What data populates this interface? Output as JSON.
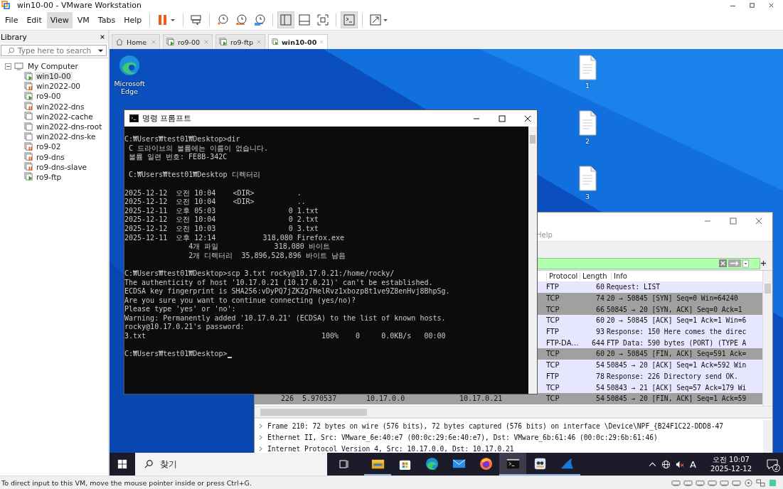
{
  "window": {
    "title": "win10-00 - VMware Workstation"
  },
  "menu": [
    {
      "label": "File",
      "selected": false
    },
    {
      "label": "Edit",
      "selected": false
    },
    {
      "label": "View",
      "selected": true
    },
    {
      "label": "VM",
      "selected": false
    },
    {
      "label": "Tabs",
      "selected": false
    },
    {
      "label": "Help",
      "selected": false
    }
  ],
  "toolbar": [
    {
      "kind": "pause",
      "selected": false
    },
    {
      "kind": "send-keys",
      "selected": false
    },
    {
      "kind": "snapshot-take",
      "selected": false
    },
    {
      "kind": "snapshot-revert",
      "selected": false
    },
    {
      "kind": "snapshot-manager",
      "selected": false
    },
    {
      "kind": "library-view",
      "selected": true
    },
    {
      "kind": "thumbnail-bar",
      "selected": false
    },
    {
      "kind": "full-screen",
      "selected": false
    },
    {
      "kind": "console-view",
      "selected": true
    },
    {
      "kind": "stretch",
      "selected": false
    }
  ],
  "library": {
    "title": "Library",
    "search": {
      "placeholder": "Type here to search"
    },
    "tree": [
      {
        "label": "My Computer",
        "expanded": true,
        "children": [
          {
            "label": "win10-00",
            "running": true,
            "paused": false,
            "selected": true
          },
          {
            "label": "win2022-00",
            "running": false,
            "paused": true,
            "selected": false
          },
          {
            "label": "ro9-00",
            "running": true,
            "paused": false,
            "selected": false
          },
          {
            "label": "win2022-dns",
            "running": false,
            "paused": true,
            "selected": false
          },
          {
            "label": "win2022-cache",
            "running": false,
            "paused": false,
            "selected": false
          },
          {
            "label": "win2022-dns-root",
            "running": false,
            "paused": false,
            "selected": false
          },
          {
            "label": "win2022-dns-ke",
            "running": false,
            "paused": false,
            "selected": false
          },
          {
            "label": "ro9-02",
            "running": false,
            "paused": true,
            "selected": false
          },
          {
            "label": "ro9-dns",
            "running": false,
            "paused": true,
            "selected": false
          },
          {
            "label": "ro9-dns-slave",
            "running": false,
            "paused": true,
            "selected": false
          },
          {
            "label": "ro9-ftp",
            "running": true,
            "paused": false,
            "selected": false
          }
        ]
      }
    ]
  },
  "tabs": [
    {
      "label": "Home",
      "kind": "home",
      "selected": false
    },
    {
      "label": "ro9-00",
      "kind": "vm",
      "selected": false
    },
    {
      "label": "ro9-ftp",
      "kind": "vm",
      "selected": false
    },
    {
      "label": "win10-00",
      "kind": "vm",
      "selected": true
    }
  ],
  "desktop": {
    "icons": [
      {
        "label": "Microsoft Edge",
        "kind": "edge"
      },
      {
        "label": "1",
        "kind": "file"
      },
      {
        "label": "2",
        "kind": "file"
      },
      {
        "label": "3",
        "kind": "file"
      }
    ]
  },
  "wireshark": {
    "menu_fragment": "Help",
    "columns": [
      {
        "label": "Protocol"
      },
      {
        "label": "Length"
      },
      {
        "label": "Info"
      }
    ],
    "packets": [
      {
        "protocol": "FTP",
        "length": "60",
        "info": "Request: LIST",
        "color": "#e7e6ff"
      },
      {
        "protocol": "TCP",
        "length": "74",
        "info": "20 → 50845 [SYN] Seq=0 Win=64240",
        "color": "#a0a0a0"
      },
      {
        "protocol": "TCP",
        "length": "66",
        "info": "50845 → 20 [SYN, ACK] Seq=0 Ack=1",
        "color": "#a0a0a0"
      },
      {
        "protocol": "TCP",
        "length": "60",
        "info": "20 → 50845 [ACK] Seq=1 Ack=1 Win=6",
        "color": "#e7e6ff"
      },
      {
        "protocol": "FTP",
        "length": "93",
        "info": "Response: 150 Here comes the direc",
        "color": "#e7e6ff"
      },
      {
        "protocol": "FTP-DA…",
        "length": "644",
        "info": "FTP Data: 590 bytes (PORT) (TYPE A",
        "color": "#e7e6ff"
      },
      {
        "protocol": "TCP",
        "length": "60",
        "info": "20 → 50845 [FIN, ACK] Seq=591 Ack=",
        "color": "#a0a0a0"
      },
      {
        "protocol": "TCP",
        "length": "54",
        "info": "50845 → 20 [ACK] Seq=1 Ack=592 Win",
        "color": "#e7e6ff"
      },
      {
        "protocol": "FTP",
        "length": "78",
        "info": "Response: 226 Directory send OK.",
        "color": "#e7e6ff"
      },
      {
        "protocol": "TCP",
        "length": "54",
        "info": "50843 → 21 [ACK] Seq=57 Ack=179 Wi",
        "color": "#e7e6ff"
      },
      {
        "no": "226",
        "time": "5.970537",
        "source": "10.17.0.0",
        "destination": "10.17.0.21",
        "protocol": "TCP",
        "length": "54",
        "info": "50845 → 20 [FIN, ACK] Seq=1 Ack=59",
        "color": "#a0a0a0"
      }
    ],
    "details": [
      {
        "text": "Frame 210: 72 bytes on wire (576 bits), 72 bytes captured (576 bits) on interface \\Device\\NPF_{B24F1C22-DDD8-47",
        "expanded": false
      },
      {
        "text": "Ethernet II, Src: VMware_6e:40:e7 (00:0c:29:6e:40:e7), Dst: VMware_6b:61:46 (00:0c:29:6b:61:46)",
        "expanded": false
      },
      {
        "text": "Internet Protocol Version 4, Src: 10.17.0.0, Dst: 10.17.0.21",
        "expanded": false
      }
    ]
  },
  "cmd": {
    "title": "명령 프롬프트",
    "blocks": [
      [
        "C:₩Users₩test01₩Desktop>dir",
        " C 드라이브의 볼륨에는 이름이 없습니다.",
        " 볼륨 일련 번호: FE8B-342C"
      ],
      [
        " C:₩Users₩test01₩Desktop 디렉터리"
      ],
      [
        "2025-12-12  오전 10:04    <DIR>          .",
        "2025-12-12  오전 10:04    <DIR>          ..",
        "2025-12-11  오후 05:03                 0 1.txt",
        "2025-12-12  오전 10:04                 0 2.txt",
        "2025-12-12  오전 10:03                 0 3.txt",
        "2025-12-11  오후 12:14           318,080 Firefox.exe",
        "               4개 파일             318,080 바이트",
        "               2개 디렉터리  35,896,528,896 바이트 남음"
      ],
      [
        "C:₩Users₩test01₩Desktop>scp 3.txt rocky@10.17.0.21:/home/rocky/",
        "The authenticity of host '10.17.0.21 (10.17.0.21)' can't be established.",
        "ECDSA key fingerprint is SHA256:vDyPQ7jZKZg7HelRvz1xbozp8t1ve9Z8enHvj8BhpSg.",
        "Are you sure you want to continue connecting (yes/no)?",
        "Please type 'yes' or 'no':",
        "Warning: Permanently added '10.17.0.21' (ECDSA) to the list of known hosts.",
        "rocky@10.17.0.21's password:",
        "3.txt                                         100%    0     0.0KB/s   00:00"
      ],
      [
        "C:₩Users₩test01₩Desktop>"
      ]
    ]
  },
  "taskbar": {
    "search_placeholder": "찾기",
    "apps": [
      {
        "kind": "explorer",
        "running": true,
        "selected": false
      },
      {
        "kind": "store",
        "running": false,
        "selected": false
      },
      {
        "kind": "edge",
        "running": false,
        "selected": false
      },
      {
        "kind": "mail",
        "running": false,
        "selected": false
      },
      {
        "kind": "firefox",
        "running": false,
        "selected": false
      },
      {
        "kind": "terminal",
        "running": true,
        "selected": true
      },
      {
        "kind": "app",
        "running": true,
        "selected": false
      },
      {
        "kind": "shark-fin",
        "running": true,
        "selected": false
      }
    ],
    "ime": "A",
    "time": "오전 10:07",
    "date": "2025-12-12",
    "notifications": "2"
  },
  "status_bar": {
    "text": "To direct input to this VM, move the mouse pointer inside or press Ctrl+G."
  }
}
